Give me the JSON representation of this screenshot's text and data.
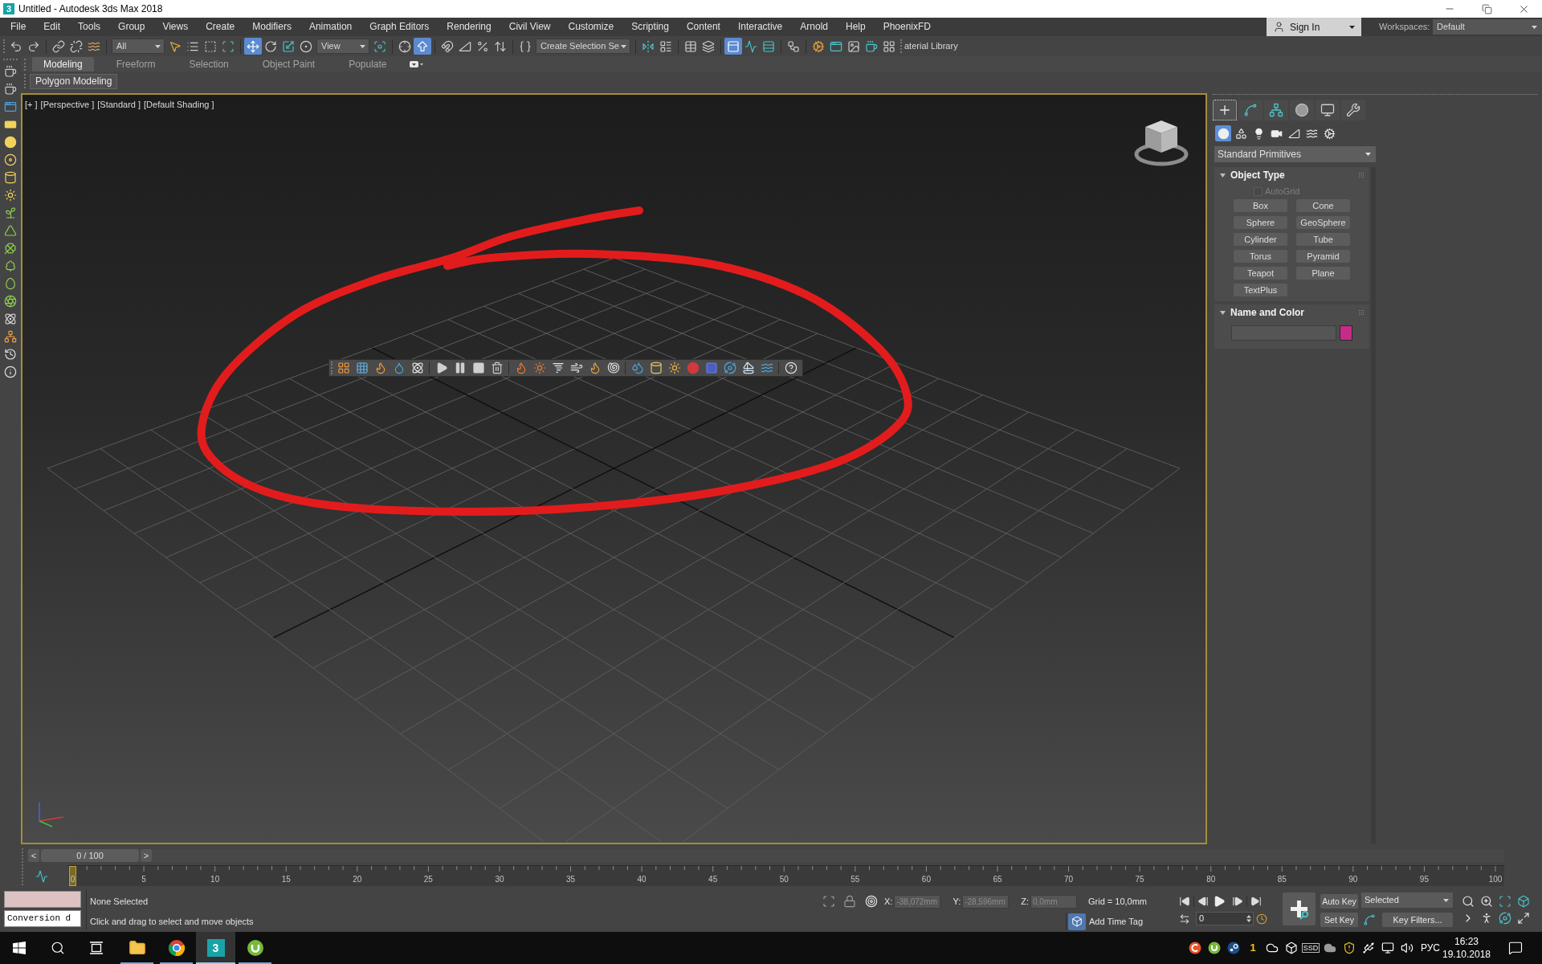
{
  "title_bar": {
    "logo_text": "3",
    "title": "Untitled - Autodesk 3ds Max 2018"
  },
  "menu_bar": {
    "items": [
      "File",
      "Edit",
      "Tools",
      "Group",
      "Views",
      "Create",
      "Modifiers",
      "Animation",
      "Graph Editors",
      "Rendering",
      "Civil View",
      "Customize",
      "Scripting",
      "Content",
      "Interactive",
      "Arnold",
      "Help",
      "PhoenixFD"
    ],
    "sign_in": "Sign In",
    "workspaces_label": "Workspaces:",
    "workspace": "Default"
  },
  "main_toolbar": {
    "selection_filter": "All",
    "select_and_move": {
      "selected": true
    },
    "reference_coordinate_system": "View",
    "keyboard_shortcut_override": {
      "selected": true
    },
    "named_selection_set": "Create Selection Se",
    "ribbon_toggle": {
      "selected": true
    },
    "material_library": "aterial Library"
  },
  "ribbon": {
    "tabs": [
      {
        "label": "Modeling",
        "selected": true
      },
      {
        "label": "Freeform",
        "selected": false
      },
      {
        "label": "Selection",
        "selected": false
      },
      {
        "label": "Object Paint",
        "selected": false
      },
      {
        "label": "Populate",
        "selected": false
      }
    ],
    "panel_button": "Polygon Modeling"
  },
  "viewport": {
    "active": true,
    "labels": [
      "[+ ]",
      "[Perspective ]",
      "[Standard ]",
      "[Default Shading ]"
    ]
  },
  "command_panel": {
    "tabs": [
      {
        "selected": true
      },
      {
        "selected": false
      },
      {
        "selected": false
      },
      {
        "selected": false
      },
      {
        "selected": false
      },
      {
        "selected": false
      }
    ],
    "categories": [
      {
        "selected": true
      },
      {
        "selected": false
      },
      {
        "selected": false
      },
      {
        "selected": false
      },
      {
        "selected": false
      },
      {
        "selected": false
      },
      {
        "selected": false
      }
    ],
    "category_dropdown": "Standard Primitives",
    "object_type": {
      "title": "Object Type",
      "expanded": true,
      "autogrid": {
        "label": "AutoGrid",
        "checked": false,
        "disabled": true
      },
      "buttons": [
        "Box",
        "Cone",
        "Sphere",
        "GeoSphere",
        "Cylinder",
        "Tube",
        "Torus",
        "Pyramid",
        "Teapot",
        "Plane",
        "TextPlus"
      ]
    },
    "name_and_color": {
      "title": "Name and Color",
      "expanded": true
    }
  },
  "time_slider": {
    "previous": "<",
    "label": "0 / 100",
    "next": ">",
    "level": 0
  },
  "track_bar": {
    "frame_labels": [
      "0",
      "5",
      "10",
      "15",
      "20",
      "25",
      "30",
      "35",
      "40",
      "45",
      "50",
      "55",
      "60",
      "65",
      "70",
      "75",
      "80",
      "85",
      "90",
      "95",
      "100"
    ],
    "level": 0
  },
  "status_bar": {
    "listener_output": "Conversion d",
    "selection": "None Selected",
    "prompt": "Click and drag to select and move objects",
    "coordinates": [
      {
        "axis": "X:",
        "value": "-38,072mm",
        "disabled": true
      },
      {
        "axis": "Y:",
        "value": "-28,596mm",
        "disabled": true
      },
      {
        "axis": "Z:",
        "value": "0,0mm",
        "disabled": true
      }
    ],
    "grid": "Grid = 10,0mm",
    "add_time_tag": "Add Time Tag",
    "current_frame": "0",
    "auto_key": {
      "label": "Auto Key",
      "on": false
    },
    "set_key": "Set Key",
    "key_set": "Selected",
    "key_filters": "Key Filters..."
  },
  "taskbar": {
    "file_explorer": {
      "running": true,
      "selected": false
    },
    "browser": {
      "running": true,
      "selected": false
    },
    "max": {
      "logo_text": "3",
      "running": true,
      "selected": true
    },
    "torrent": {
      "running": true,
      "selected": false
    },
    "tray_badge": "1",
    "ssd_label": "SSD",
    "language": "РУС",
    "time": "16:23",
    "date": "19.10.2018"
  }
}
